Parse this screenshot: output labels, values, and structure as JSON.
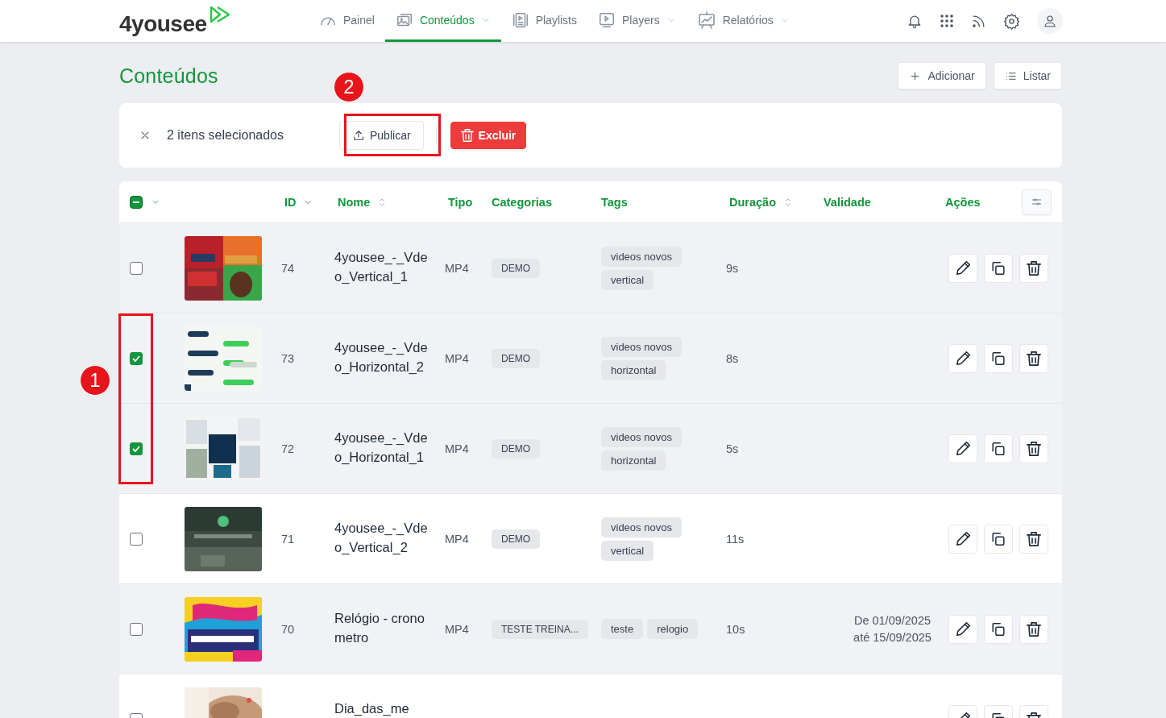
{
  "brand": {
    "name": "4yousee"
  },
  "nav": [
    {
      "label": "Painel",
      "has_menu": false,
      "selected": false
    },
    {
      "label": "Conteúdos",
      "has_menu": true,
      "selected": true
    },
    {
      "label": "Playlists",
      "has_menu": false,
      "selected": false
    },
    {
      "label": "Players",
      "has_menu": true,
      "selected": false
    },
    {
      "label": "Relatórios",
      "has_menu": true,
      "selected": false
    }
  ],
  "page": {
    "title": "Conteúdos",
    "actions": [
      {
        "label": "Adicionar",
        "kind": "add"
      },
      {
        "label": "Listar",
        "kind": "list"
      }
    ]
  },
  "selection_bar": {
    "count_text": "2 itens selecionados",
    "actions": [
      {
        "label": "Publicar",
        "kind": "publish"
      },
      {
        "label": "Excluir",
        "kind": "delete"
      }
    ]
  },
  "table": {
    "select_all": {
      "indeterminate": true
    },
    "columns": [
      {
        "label": "ID",
        "sortable": true,
        "sorted": true
      },
      {
        "label": "Nome",
        "sortable": true,
        "sorted": false
      },
      {
        "label": "Tipo",
        "sortable": false,
        "sorted": false
      },
      {
        "label": "Categorias",
        "sortable": false,
        "sorted": false
      },
      {
        "label": "Tags",
        "sortable": false,
        "sorted": false
      },
      {
        "label": "Duração",
        "sortable": true,
        "sorted": false
      },
      {
        "label": "Validade",
        "sortable": false,
        "sorted": false
      },
      {
        "label": "Ações",
        "sortable": false,
        "sorted": false
      }
    ],
    "rows": [
      {
        "id": "74",
        "name": "4yousee_-_Vdeo_Vertical_1",
        "type": "MP4",
        "categories": [
          "DEMO"
        ],
        "tags": [
          "videos novos",
          "vertical"
        ],
        "duration": "9s",
        "checked": false,
        "shaded": true
      },
      {
        "id": "73",
        "name": "4yousee_-_Vdeo_Horizontal_2",
        "type": "MP4",
        "categories": [
          "DEMO"
        ],
        "tags": [
          "videos novos",
          "horizontal"
        ],
        "duration": "8s",
        "checked": true,
        "shaded": true
      },
      {
        "id": "72",
        "name": "4yousee_-_Vdeo_Horizontal_1",
        "type": "MP4",
        "categories": [
          "DEMO"
        ],
        "tags": [
          "videos novos",
          "horizontal"
        ],
        "duration": "5s",
        "checked": true,
        "shaded": true
      },
      {
        "id": "71",
        "name": "4yousee_-_Vdeo_Vertical_2",
        "type": "MP4",
        "categories": [
          "DEMO"
        ],
        "tags": [
          "videos novos",
          "vertical"
        ],
        "duration": "11s",
        "checked": false,
        "shaded": false
      },
      {
        "id": "70",
        "name": "Relógio - cronometro",
        "type": "MP4",
        "categories": [
          "TESTE TREINA..."
        ],
        "tags": [
          "teste",
          "relogio"
        ],
        "duration": "10s",
        "validity": [
          "De 01/09/2025",
          "até 15/09/2025"
        ],
        "checked": false,
        "shaded": true
      },
      {
        "name": "Dia_das_me",
        "checked": false,
        "shaded": false
      }
    ]
  },
  "annotations": [
    {
      "number": "1"
    },
    {
      "number": "2"
    }
  ]
}
